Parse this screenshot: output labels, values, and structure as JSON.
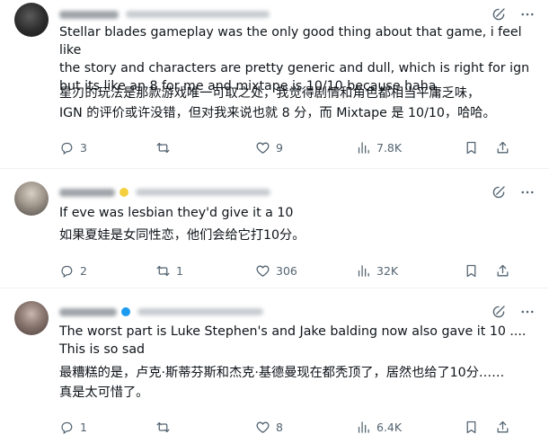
{
  "posts": [
    {
      "text": "Stellar blades gameplay was the only good thing about that game, i feel like\nthe story and characters are pretty generic and dull, which is right for ign\nbut its like an 8 for me and mixtape is 10/10 because haha",
      "translation": "星刃的玩法是那款游戏唯一可取之处，我觉得剧情和角色都相当平庸乏味，\nIGN 的评价或许没错，但对我来说也就 8 分，而 Mixtape 是 10/10，哈哈。",
      "replies": "3",
      "reposts": "",
      "likes": "9",
      "views": "7.8K",
      "verified_color": "#ffffff"
    },
    {
      "text": "If eve was lesbian they'd give it a 10",
      "translation": "如果夏娃是女同性恋，他们会给它打10分。",
      "replies": "2",
      "reposts": "1",
      "likes": "306",
      "views": "32K",
      "verified_color": "#f4d03f"
    },
    {
      "text": "The worst part is Luke Stephen's and Jake balding now also gave it 10 ....\nThis is so sad",
      "translation": "最糟糕的是，卢克·斯蒂芬斯和杰克·基德曼现在都秃顶了，居然也给了10分……\n真是太可惜了。",
      "replies": "1",
      "reposts": "",
      "likes": "8",
      "views": "6.4K",
      "verified_color": "#1d9bf0"
    }
  ],
  "icons": {
    "reply": "reply-icon",
    "repost": "repost-icon",
    "like": "heart-icon",
    "views": "views-chart-icon",
    "bookmark": "bookmark-icon",
    "share": "share-icon",
    "grok": "grok-icon",
    "more": "more-icon"
  },
  "colors": {
    "text": "#0f1419",
    "muted": "#536471",
    "divider": "#eff3f4",
    "verified_blue": "#1d9bf0"
  }
}
